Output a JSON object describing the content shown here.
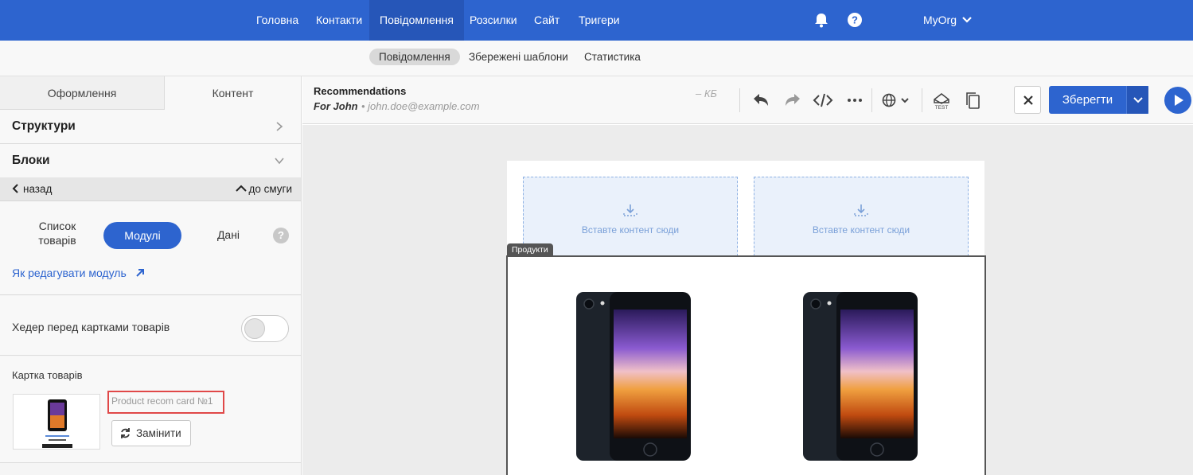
{
  "topnav": {
    "items": [
      "Головна",
      "Контакти",
      "Повідомлення",
      "Розсилки",
      "Сайт",
      "Тригери"
    ],
    "active": "Повідомлення",
    "org": "MyOrg",
    "icons": [
      "bell-icon",
      "help-icon",
      "chevron-down-icon"
    ]
  },
  "subnav": {
    "items": [
      "Повідомлення",
      "Збережені шаблони",
      "Статистика"
    ],
    "active": "Повідомлення"
  },
  "left": {
    "tabs": [
      "Оформлення",
      "Контент"
    ],
    "sections": [
      "Структури",
      "Блоки"
    ],
    "back": "назад",
    "to_strip": "до смуги",
    "modes": {
      "list": "Список товарів",
      "modules": "Модулі",
      "data": "Дані"
    },
    "help": "?",
    "link": "Як редагувати модуль",
    "header_before_cards": "Хедер перед картками товарів",
    "header_toggle_on": false,
    "product_card_label": "Картка товарів",
    "card_name": "Product recom card №1",
    "replace": "Замінити"
  },
  "editor": {
    "name": "Recommendations",
    "for": "For John",
    "email": "john.doe@example.com",
    "size": "– КБ",
    "tools": [
      "undo-icon",
      "redo-icon",
      "code-icon",
      "more-icon",
      "globe-icon",
      "test-icon",
      "copy-icon"
    ],
    "test_label": "TEST",
    "save": "Зберегти"
  },
  "canvas": {
    "drop_text": "Вставте контент сюди",
    "products_tag": "Продукти"
  },
  "colors": {
    "brand": "#2d64cf",
    "highlight": "#e04848"
  }
}
